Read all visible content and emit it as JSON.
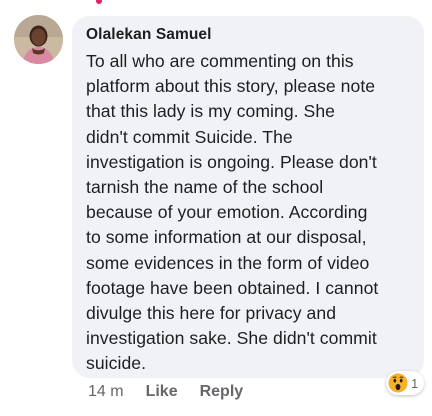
{
  "comment": {
    "author": "Olalekan Samuel",
    "text_lines": [
      "To all who are commenting on this",
      "platform about this story, please note",
      "that this lady is my coming. She",
      "didn't commit Suicide. The",
      "investigation is ongoing. Please don't",
      "tarnish the name of the school",
      "because of your emotion. According",
      "to some information at our disposal,",
      "some evidences in the form of video",
      "footage have been obtained. I cannot",
      "divulge this here for privacy and",
      "investigation sake. She didn't commit",
      "suicide."
    ]
  },
  "actions": {
    "time": "14 m",
    "like_label": "Like",
    "reply_label": "Reply"
  },
  "reaction": {
    "icon": "wow-icon",
    "count": "1"
  },
  "colors": {
    "bubble": "#f0f2f5",
    "text": "#1c1e21",
    "meta": "#65676b",
    "wow": "#f7b125"
  }
}
